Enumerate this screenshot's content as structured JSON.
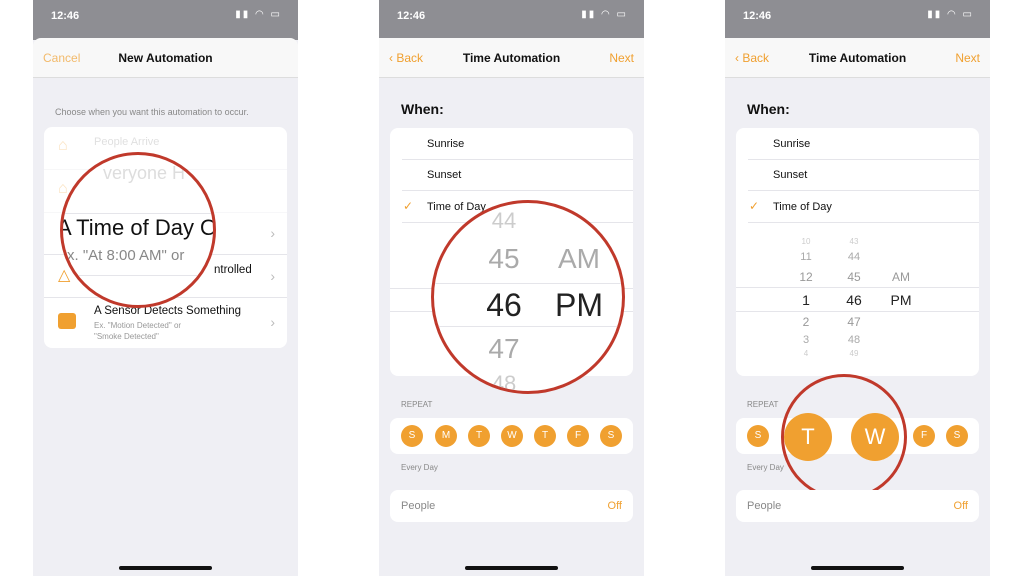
{
  "status_time": "12:46",
  "accent": "#f0a030",
  "phone1": {
    "cancel": "Cancel",
    "title": "New Automation",
    "hint": "Choose when you want this automation to occur.",
    "rows": [
      {
        "title": "People Arrive",
        "sub": ""
      },
      {
        "title": "Everyone Home?",
        "sub": ""
      },
      {
        "title": "A Time of Day Occurs",
        "sub": "Ex. \"At 8:00 AM\" or"
      },
      {
        "title": "An Accessory is Controlled",
        "sub": ""
      },
      {
        "title": "A Sensor Detects Something",
        "sub": "Ex. \"Motion Detected\" or",
        "sub2": "\"Smoke Detected\""
      }
    ],
    "mag_title": "A Time of Day O",
    "mag_sub": "Ex. \"At 8:00 AM\" or",
    "mag_faded": "veryone H",
    "mag_right": "ntrolled"
  },
  "phone2": {
    "back": "Back",
    "title": "Time Automation",
    "next": "Next",
    "when": "When:",
    "options": [
      "Sunrise",
      "Sunset",
      "Time of Day"
    ],
    "selected": "Time of Day",
    "picker": {
      "minutes": [
        "44",
        "45",
        "46",
        "47",
        "48"
      ],
      "ampm": [
        "AM",
        "PM"
      ]
    },
    "repeat": "REPEAT",
    "days": [
      "S",
      "M",
      "T",
      "W",
      "T",
      "F",
      "S"
    ],
    "every_day": "Every Day",
    "people": "People",
    "people_value": "Off"
  },
  "phone3": {
    "back": "Back",
    "title": "Time Automation",
    "next": "Next",
    "when": "When:",
    "options": [
      "Sunrise",
      "Sunset",
      "Time of Day"
    ],
    "picker": {
      "hours": [
        "10",
        "11",
        "12",
        "1",
        "2",
        "3",
        "4"
      ],
      "minutes": [
        "43",
        "44",
        "45",
        "46",
        "47",
        "48",
        "49"
      ],
      "ampm": [
        "AM",
        "PM"
      ]
    },
    "repeat": "REPEAT",
    "days": [
      "S",
      "T",
      "W",
      "F",
      "S"
    ],
    "every_day": "Every Day",
    "people": "People",
    "people_value": "Off"
  }
}
